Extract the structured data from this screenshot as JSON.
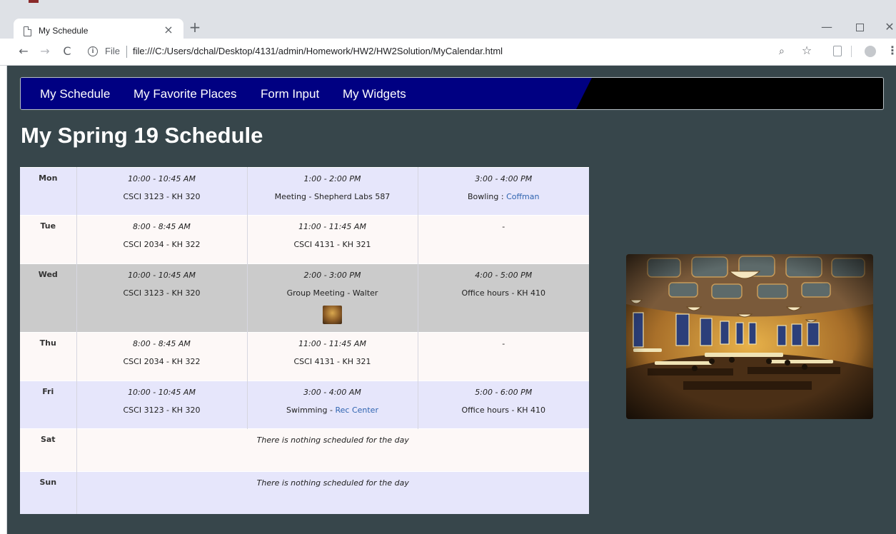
{
  "browser": {
    "tab_title": "My Schedule",
    "tab_close": "×",
    "new_tab": "+",
    "window_controls": {
      "minimize": "—",
      "maximize": "□",
      "close": "✕"
    },
    "nav": {
      "back": "←",
      "forward": "→",
      "reload": "C"
    },
    "omnibox": {
      "info": "i",
      "scheme_label": "File",
      "url": "file:///C:/Users/dchal/Desktop/4131/admin/Homework/HW2/HW2Solution/MyCalendar.html"
    },
    "icons": {
      "zoom": "⌕",
      "star": "☆",
      "menu": "⋮"
    }
  },
  "navbar": {
    "links": [
      "My Schedule",
      "My Favorite Places",
      "Form Input",
      "My Widgets"
    ],
    "colors": {
      "left": "#000082",
      "right": "#000000"
    }
  },
  "page": {
    "title": "My Spring 19 Schedule",
    "background": "#37464b"
  },
  "schedule": {
    "rows": [
      {
        "day": "Mon",
        "slots": [
          {
            "time": "10:00 - 10:45 AM",
            "desc": "CSCI 3123 - KH 320"
          },
          {
            "time": "1:00 - 2:00 PM",
            "desc": "Meeting - Shepherd Labs 587"
          },
          {
            "time": "3:00 - 4:00 PM",
            "desc_prefix": "Bowling : ",
            "link": "Coffman"
          }
        ]
      },
      {
        "day": "Tue",
        "slots": [
          {
            "time": "8:00 - 8:45 AM",
            "desc": "CSCI 2034 - KH 322"
          },
          {
            "time": "11:00 - 11:45 AM",
            "desc": "CSCI 4131 - KH 321"
          },
          {
            "empty": "-"
          }
        ]
      },
      {
        "day": "Wed",
        "slots": [
          {
            "time": "10:00 - 10:45 AM",
            "desc": "CSCI 3123 - KH 320"
          },
          {
            "time": "2:00 - 3:00 PM",
            "desc": "Group Meeting - Walter"
          },
          {
            "time": "4:00 - 5:00 PM",
            "desc": "Office hours - KH 410"
          }
        ]
      },
      {
        "day": "Thu",
        "slots": [
          {
            "time": "8:00 - 8:45 AM",
            "desc": "CSCI 2034 - KH 322"
          },
          {
            "time": "11:00 - 11:45 AM",
            "desc": "CSCI 4131 - KH 321"
          },
          {
            "empty": "-"
          }
        ]
      },
      {
        "day": "Fri",
        "slots": [
          {
            "time": "10:00 - 10:45 AM",
            "desc": "CSCI 3123 - KH 320"
          },
          {
            "time": "3:00 - 4:00 AM",
            "desc_prefix": "Swimming - ",
            "link": "Rec Center"
          },
          {
            "time": "5:00 - 6:00 PM",
            "desc": "Office hours - KH 410"
          }
        ]
      },
      {
        "day": "Sat",
        "nothing": "There is nothing scheduled for the day"
      },
      {
        "day": "Sun",
        "nothing": "There is nothing scheduled for the day"
      }
    ],
    "colors": {
      "row_blue": "#e6e6fb",
      "row_white": "#fdf8f7",
      "row_grey": "#cbcbcb",
      "link": "#2f64b0"
    }
  }
}
